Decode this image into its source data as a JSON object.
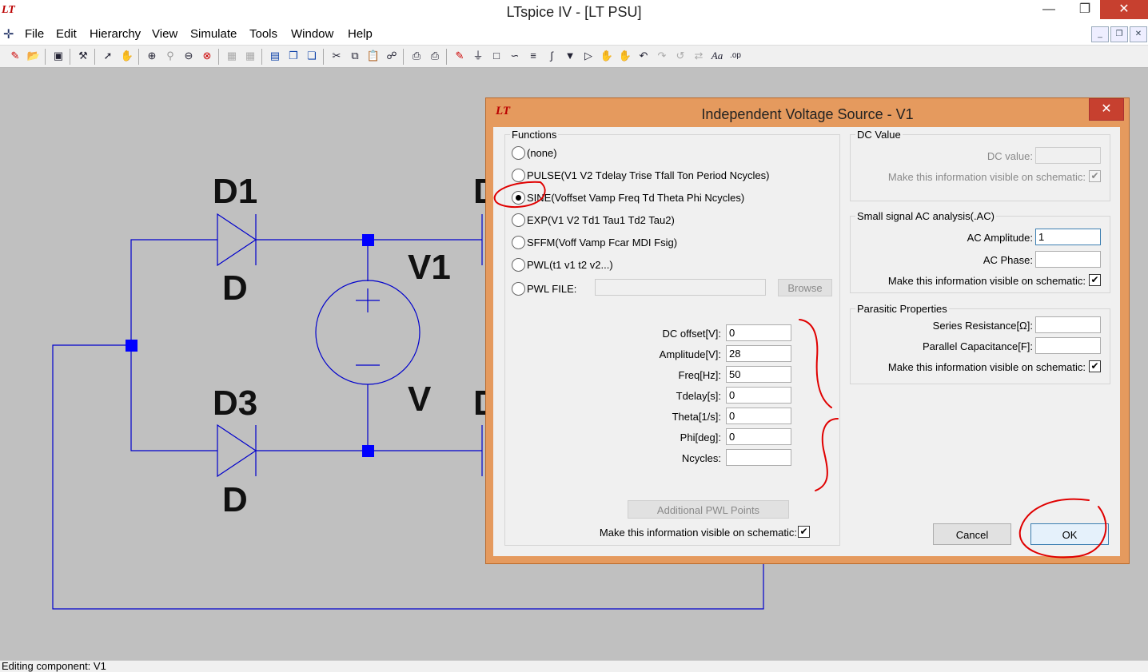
{
  "window": {
    "title": "LTspice IV - [LT PSU]",
    "logo": "LT",
    "minimize_icon": "minimize-icon",
    "maximize_icon": "restore-icon",
    "close_icon": "close-icon"
  },
  "menu": {
    "file": "File",
    "edit": "Edit",
    "hierarchy": "Hierarchy",
    "view": "View",
    "simulate": "Simulate",
    "tools": "Tools",
    "window": "Window",
    "help": "Help"
  },
  "schematic": {
    "components": {
      "d1_name": "D1",
      "d1_value": "D",
      "d3_name": "D3",
      "d3_value": "D",
      "d2_name_partial": "D",
      "d4_name_partial": "D",
      "v1_name": "V1",
      "v1_value": "V"
    },
    "wire_color": "#0000cc",
    "node_color": "#0000ff"
  },
  "status": {
    "text": "Editing component: V1"
  },
  "dialog": {
    "title": "Independent Voltage Source - V1",
    "functions": {
      "group_title": "Functions",
      "options": [
        {
          "label": "(none)",
          "selected": false
        },
        {
          "label": "PULSE(V1 V2 Tdelay Trise Tfall Ton Period Ncycles)",
          "selected": false
        },
        {
          "label": "SINE(Voffset Vamp Freq Td Theta Phi Ncycles)",
          "selected": true
        },
        {
          "label": "EXP(V1 V2 Td1 Tau1 Td2 Tau2)",
          "selected": false
        },
        {
          "label": "SFFM(Voff Vamp Fcar MDI Fsig)",
          "selected": false
        },
        {
          "label": "PWL(t1 v1 t2 v2...)",
          "selected": false
        },
        {
          "label": "PWL FILE:",
          "selected": false
        }
      ],
      "pwl_file_value": "",
      "browse_label": "Browse",
      "params": [
        {
          "label": "DC offset[V]:",
          "value": "0"
        },
        {
          "label": "Amplitude[V]:",
          "value": "28"
        },
        {
          "label": "Freq[Hz]:",
          "value": "50"
        },
        {
          "label": "Tdelay[s]:",
          "value": "0"
        },
        {
          "label": "Theta[1/s]:",
          "value": "0"
        },
        {
          "label": "Phi[deg]:",
          "value": "0"
        },
        {
          "label": "Ncycles:",
          "value": ""
        }
      ],
      "additional_pwl_label": "Additional PWL Points",
      "visible_label": "Make this information visible on schematic:",
      "visible_checked": true
    },
    "dc_value": {
      "group_title": "DC Value",
      "dc_label": "DC value:",
      "dc_value": "",
      "visible_label": "Make this information visible on schematic:",
      "visible_checked": true
    },
    "ac": {
      "group_title": "Small signal AC analysis(.AC)",
      "amp_label": "AC Amplitude:",
      "amp_value": "1",
      "phase_label": "AC Phase:",
      "phase_value": "",
      "visible_label": "Make this information visible on schematic:",
      "visible_checked": true
    },
    "parasitic": {
      "group_title": "Parasitic Properties",
      "rser_label": "Series Resistance[Ω]:",
      "rser_value": "",
      "cpar_label": "Parallel Capacitance[F]:",
      "cpar_value": "",
      "visible_label": "Make this information visible on schematic:",
      "visible_checked": true
    },
    "cancel_label": "Cancel",
    "ok_label": "OK",
    "check_mark": "✔",
    "accent_color": "#e59a5e",
    "annotation_color": "#e00000"
  }
}
